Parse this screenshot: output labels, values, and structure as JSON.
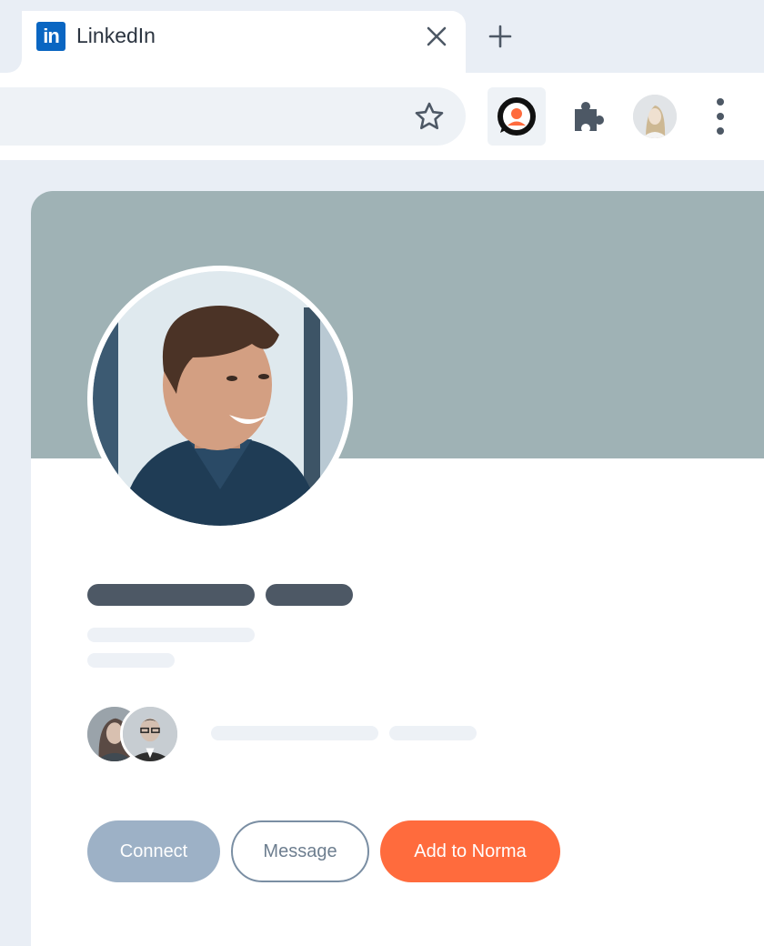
{
  "browser": {
    "tab": {
      "title": "LinkedIn",
      "favicon": "linkedin-icon"
    },
    "new_tab_icon": "plus-icon",
    "toolbar": {
      "icons": [
        "star-icon",
        "norma-extension-icon",
        "puzzle-icon",
        "profile-avatar",
        "more-vert-icon"
      ]
    }
  },
  "profile": {
    "actions": {
      "connect_label": "Connect",
      "message_label": "Message",
      "add_label": "Add to Norma"
    }
  },
  "colors": {
    "banner": "#9fb2b5",
    "accent": "#ff6b3d",
    "connect": "#9db1c6",
    "linkedin_blue": "#0a66c2",
    "skeleton_dark": "#4d5865",
    "skeleton_light": "#edf1f6"
  }
}
